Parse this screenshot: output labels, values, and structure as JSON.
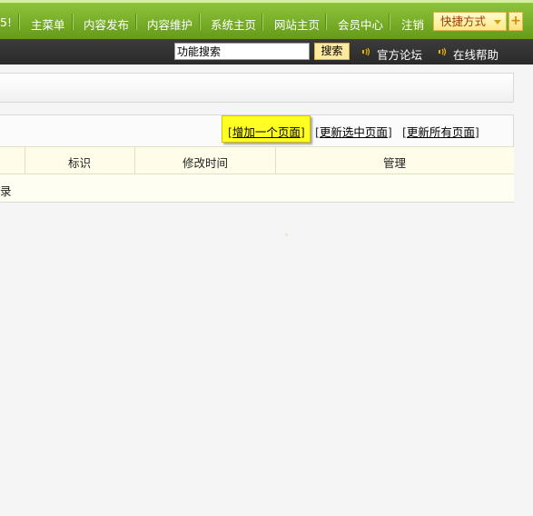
{
  "topnav": {
    "clipped_item": "5!",
    "items": [
      {
        "label": "主菜单"
      },
      {
        "label": "内容发布"
      },
      {
        "label": "内容维护"
      },
      {
        "label": "系统主页"
      },
      {
        "label": "网站主页"
      },
      {
        "label": "会员中心"
      },
      {
        "label": "注销"
      }
    ],
    "shortcut_label": "快捷方式",
    "plus_label": "+"
  },
  "subbar": {
    "search_value": "功能搜索",
    "search_button": "搜索",
    "links": [
      {
        "label": "官方论坛"
      },
      {
        "label": "在线帮助"
      }
    ]
  },
  "actions": {
    "add_page": "增加一个页面",
    "update_selected": "更新选中页面",
    "update_all": "更新所有页面"
  },
  "table": {
    "headers": [
      "标识",
      "修改时间",
      "管理"
    ],
    "empty_row_text": "录"
  },
  "colors": {
    "nav_green": "#7cb22c",
    "subbar_dark": "#2f2f2f",
    "highlight_yellow": "#ffff22",
    "header_cream": "#fffde9"
  }
}
